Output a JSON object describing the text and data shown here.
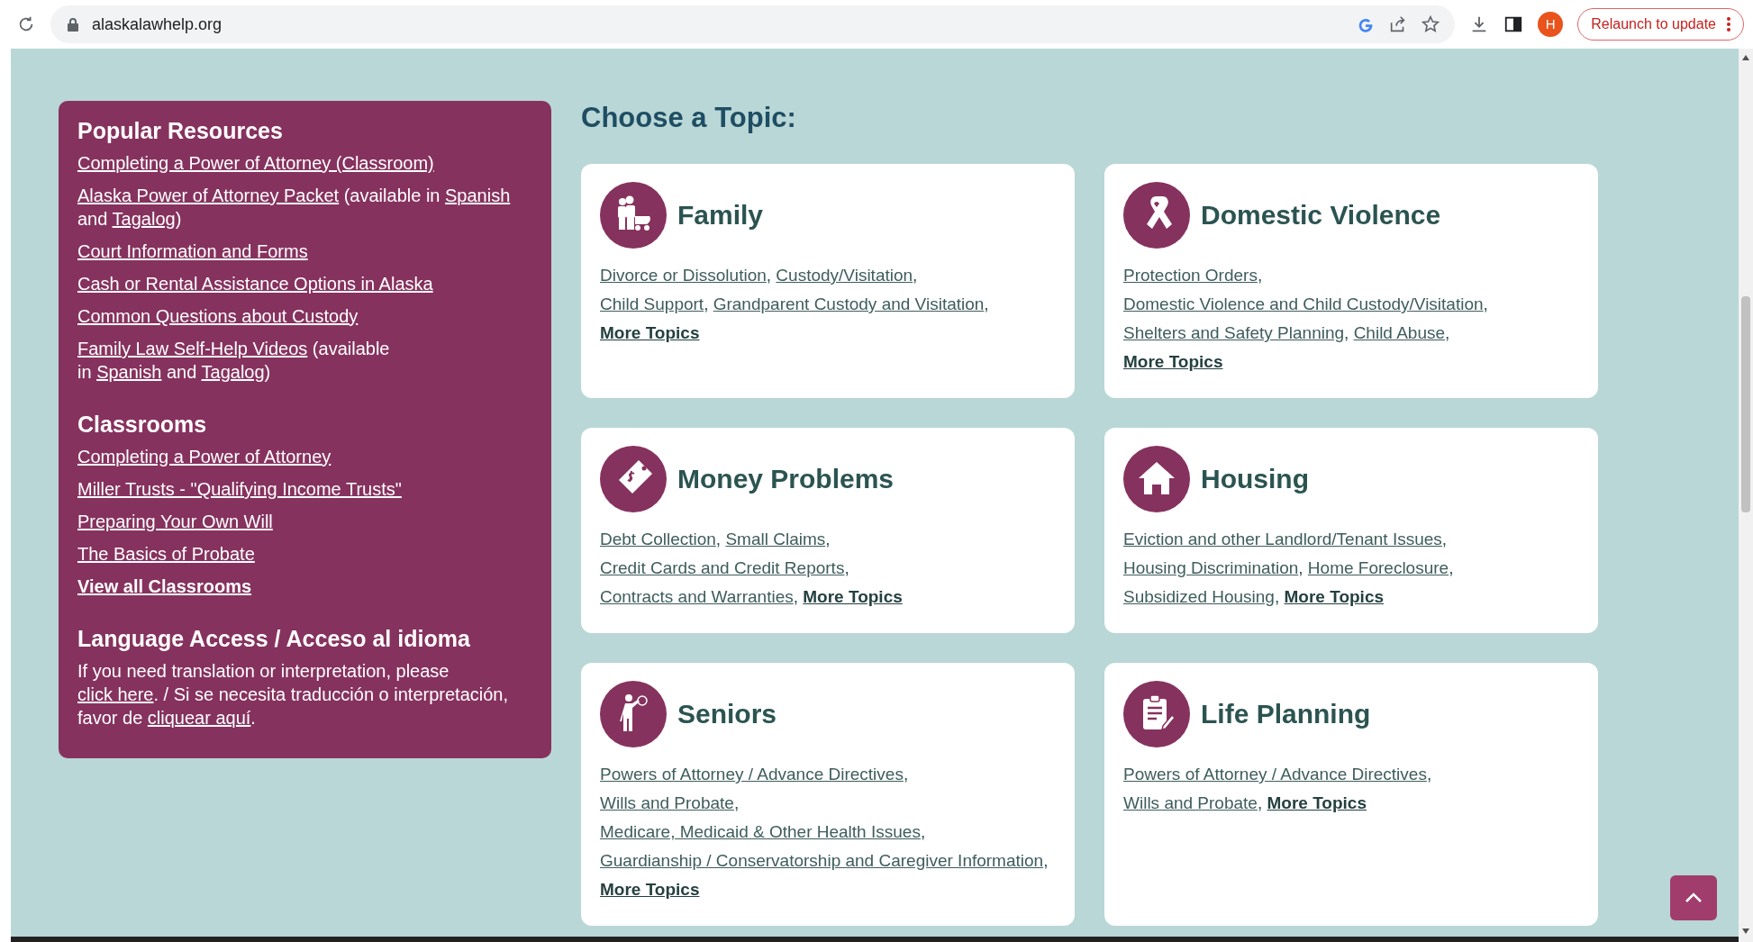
{
  "browser": {
    "url": "alaskalawhelp.org",
    "profile_initial": "H",
    "update_button": "Relaunch to update"
  },
  "sidebar": {
    "sections": [
      {
        "heading": "Popular Resources",
        "items": [
          {
            "parts": [
              {
                "text": "Completing a Power of Attorney (Classroom)",
                "kind": "link"
              }
            ]
          },
          {
            "parts": [
              {
                "text": "Alaska Power of Attorney Packet",
                "kind": "link"
              },
              {
                "text": " (available in ",
                "kind": "text"
              },
              {
                "text": "Spanish",
                "kind": "link"
              },
              {
                "text": " and ",
                "kind": "text"
              },
              {
                "text": "Tagalog",
                "kind": "link"
              },
              {
                "text": ")",
                "kind": "text"
              }
            ]
          },
          {
            "parts": [
              {
                "text": "Court Information and Forms",
                "kind": "link"
              }
            ]
          },
          {
            "parts": [
              {
                "text": "Cash or Rental Assistance Options in Alaska",
                "kind": "link"
              }
            ]
          },
          {
            "parts": [
              {
                "text": "Common Questions about Custody",
                "kind": "link"
              }
            ]
          },
          {
            "parts": [
              {
                "text": "Family Law Self-Help Videos",
                "kind": "link"
              },
              {
                "text": " (available",
                "kind": "text"
              },
              {
                "kind": "break"
              },
              {
                "text": "in ",
                "kind": "text"
              },
              {
                "text": "Spanish",
                "kind": "link"
              },
              {
                "text": " and ",
                "kind": "text"
              },
              {
                "text": "Tagalog",
                "kind": "link"
              },
              {
                "text": ")",
                "kind": "text"
              }
            ]
          }
        ]
      },
      {
        "heading": "Classrooms",
        "items": [
          {
            "parts": [
              {
                "text": "Completing a Power of Attorney",
                "kind": "link"
              }
            ]
          },
          {
            "parts": [
              {
                "text": "Miller Trusts - \"Qualifying Income Trusts\"",
                "kind": "link"
              }
            ]
          },
          {
            "parts": [
              {
                "text": "Preparing Your Own Will",
                "kind": "link"
              }
            ]
          },
          {
            "parts": [
              {
                "text": "The Basics of Probate",
                "kind": "link"
              }
            ]
          },
          {
            "parts": [
              {
                "text": "View all Classrooms",
                "kind": "more"
              }
            ]
          }
        ]
      },
      {
        "heading": "Language Access / Acceso al idioma",
        "items": [
          {
            "parts": [
              {
                "text": "If you need translation or interpretation, please ",
                "kind": "text"
              },
              {
                "text": "click here",
                "kind": "link"
              },
              {
                "text": ". / Si se necesita traducción o interpretación, favor de ",
                "kind": "text"
              },
              {
                "text": "cliquear aquí",
                "kind": "link"
              },
              {
                "text": ".",
                "kind": "text"
              }
            ]
          }
        ]
      }
    ]
  },
  "main": {
    "heading": "Choose a Topic:",
    "topics": [
      {
        "title": "Family",
        "links": [
          {
            "text": "Divorce or Dissolution",
            "kind": "link"
          },
          {
            "text": ", ",
            "kind": "text"
          },
          {
            "text": "Custody/Visitation",
            "kind": "link"
          },
          {
            "text": ",",
            "kind": "text"
          },
          {
            "kind": "break"
          },
          {
            "text": "Child Support",
            "kind": "link"
          },
          {
            "text": ", ",
            "kind": "text"
          },
          {
            "text": "Grandparent Custody and Visitation",
            "kind": "link"
          },
          {
            "text": ",",
            "kind": "text"
          },
          {
            "kind": "break"
          },
          {
            "text": "More Topics",
            "kind": "more"
          }
        ]
      },
      {
        "title": "Domestic Violence",
        "links": [
          {
            "text": "Protection Orders",
            "kind": "link"
          },
          {
            "text": ",",
            "kind": "text"
          },
          {
            "kind": "break"
          },
          {
            "text": "Domestic Violence and Child Custody/Visitation",
            "kind": "link"
          },
          {
            "text": ",",
            "kind": "text"
          },
          {
            "kind": "break"
          },
          {
            "text": "Shelters and Safety Planning",
            "kind": "link"
          },
          {
            "text": ", ",
            "kind": "text"
          },
          {
            "text": "Child Abuse",
            "kind": "link"
          },
          {
            "text": ",",
            "kind": "text"
          },
          {
            "kind": "break"
          },
          {
            "text": "More Topics",
            "kind": "more"
          }
        ]
      },
      {
        "title": "Money Problems",
        "links": [
          {
            "text": "Debt Collection",
            "kind": "link"
          },
          {
            "text": ", ",
            "kind": "text"
          },
          {
            "text": "Small Claims",
            "kind": "link"
          },
          {
            "text": ",",
            "kind": "text"
          },
          {
            "kind": "break"
          },
          {
            "text": "Credit Cards and Credit Reports",
            "kind": "link"
          },
          {
            "text": ",",
            "kind": "text"
          },
          {
            "kind": "break"
          },
          {
            "text": "Contracts and Warranties",
            "kind": "link"
          },
          {
            "text": ", ",
            "kind": "text"
          },
          {
            "text": "More Topics",
            "kind": "more"
          }
        ]
      },
      {
        "title": "Housing",
        "links": [
          {
            "text": "Eviction and other Landlord/Tenant Issues",
            "kind": "link"
          },
          {
            "text": ",",
            "kind": "text"
          },
          {
            "kind": "break"
          },
          {
            "text": "Housing Discrimination",
            "kind": "link"
          },
          {
            "text": ", ",
            "kind": "text"
          },
          {
            "text": "Home Foreclosure",
            "kind": "link"
          },
          {
            "text": ",",
            "kind": "text"
          },
          {
            "kind": "break"
          },
          {
            "text": "Subsidized Housing",
            "kind": "link"
          },
          {
            "text": ", ",
            "kind": "text"
          },
          {
            "text": "More Topics",
            "kind": "more"
          }
        ]
      },
      {
        "title": "Seniors",
        "links": [
          {
            "text": "Powers of Attorney / Advance Directives",
            "kind": "link"
          },
          {
            "text": ",",
            "kind": "text"
          },
          {
            "kind": "break"
          },
          {
            "text": "Wills and Probate",
            "kind": "link"
          },
          {
            "text": ",",
            "kind": "text"
          },
          {
            "kind": "break"
          },
          {
            "text": "Medicare, Medicaid & Other Health Issues",
            "kind": "link"
          },
          {
            "text": ",",
            "kind": "text"
          },
          {
            "kind": "break"
          },
          {
            "text": "Guardianship / Conservatorship and Caregiver Information",
            "kind": "link"
          },
          {
            "text": ",",
            "kind": "text"
          },
          {
            "kind": "break"
          },
          {
            "text": "More Topics",
            "kind": "more"
          }
        ]
      },
      {
        "title": "Life Planning",
        "links": [
          {
            "text": "Powers of Attorney / Advance Directives",
            "kind": "link"
          },
          {
            "text": ",",
            "kind": "text"
          },
          {
            "kind": "break"
          },
          {
            "text": "Wills and Probate",
            "kind": "link"
          },
          {
            "text": ", ",
            "kind": "text"
          },
          {
            "text": "More Topics",
            "kind": "more"
          }
        ]
      }
    ]
  }
}
